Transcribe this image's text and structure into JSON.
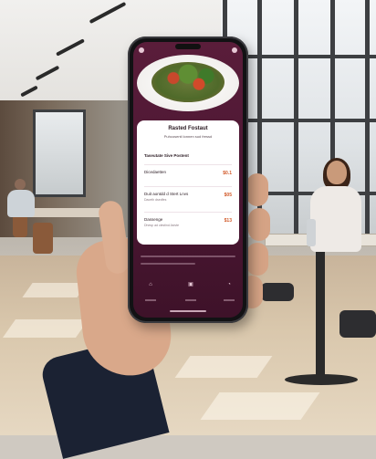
{
  "scene": {
    "description_hidden": ""
  },
  "app": {
    "title": "Rasted Fostaut",
    "subtitle": "Puhcosenti lonnen sud fressd",
    "section_heading": "Taseutate Sive Postent",
    "menu_items": [
      {
        "name": "Dicedaetten",
        "desc": "",
        "price": "$0.1"
      },
      {
        "name": "Duit aontdd d Stert Lnvs",
        "desc": "Daceth dsedfes",
        "price": "$05"
      },
      {
        "name": "Dassenge",
        "desc": "Dhesp ad clestind Asivte",
        "price": "$13"
      }
    ],
    "nav_icons": [
      "cart-icon",
      "photo-icon",
      "chat-icon"
    ],
    "accent_color": "#d25a2a",
    "screen_color": "#5a1d3a"
  }
}
